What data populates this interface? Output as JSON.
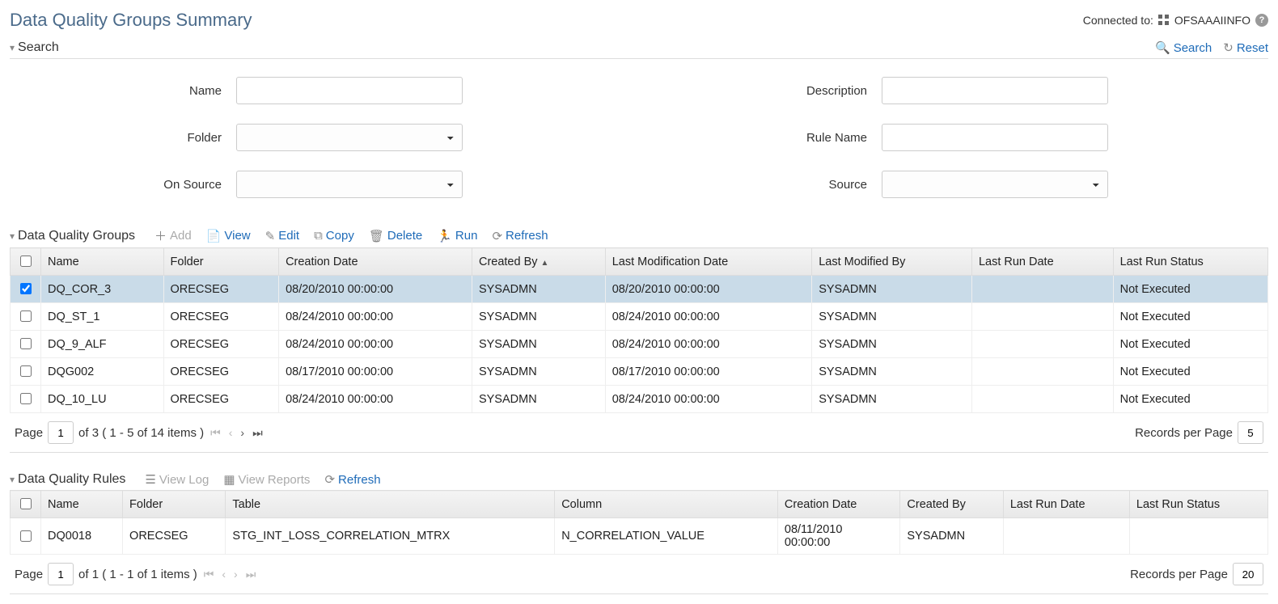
{
  "header": {
    "title": "Data Quality Groups Summary",
    "connected_label": "Connected to:",
    "connected_value": "OFSAAAIINFO"
  },
  "search_section": {
    "title": "Search",
    "search_btn": "Search",
    "reset_btn": "Reset",
    "labels": {
      "name": "Name",
      "description": "Description",
      "folder": "Folder",
      "rule_name": "Rule Name",
      "on_source": "On Source",
      "source": "Source"
    }
  },
  "groups_section": {
    "title": "Data Quality Groups",
    "toolbar": {
      "add": "Add",
      "view": "View",
      "edit": "Edit",
      "copy": "Copy",
      "delete": "Delete",
      "run": "Run",
      "refresh": "Refresh"
    },
    "columns": [
      "Name",
      "Folder",
      "Creation Date",
      "Created By",
      "Last Modification Date",
      "Last Modified By",
      "Last Run Date",
      "Last Run Status"
    ],
    "sort_col_index": 3,
    "rows": [
      {
        "checked": true,
        "cells": [
          "DQ_COR_3",
          "ORECSEG",
          "08/20/2010 00:00:00",
          "SYSADMN",
          "08/20/2010 00:00:00",
          "SYSADMN",
          "",
          "Not Executed"
        ]
      },
      {
        "checked": false,
        "cells": [
          "DQ_ST_1",
          "ORECSEG",
          "08/24/2010 00:00:00",
          "SYSADMN",
          "08/24/2010 00:00:00",
          "SYSADMN",
          "",
          "Not Executed"
        ]
      },
      {
        "checked": false,
        "cells": [
          "DQ_9_ALF",
          "ORECSEG",
          "08/24/2010 00:00:00",
          "SYSADMN",
          "08/24/2010 00:00:00",
          "SYSADMN",
          "",
          "Not Executed"
        ]
      },
      {
        "checked": false,
        "cells": [
          "DQG002",
          "ORECSEG",
          "08/17/2010 00:00:00",
          "SYSADMN",
          "08/17/2010 00:00:00",
          "SYSADMN",
          "",
          "Not Executed"
        ]
      },
      {
        "checked": false,
        "cells": [
          "DQ_10_LU",
          "ORECSEG",
          "08/24/2010 00:00:00",
          "SYSADMN",
          "08/24/2010 00:00:00",
          "SYSADMN",
          "",
          "Not Executed"
        ]
      }
    ],
    "pager": {
      "page_label": "Page",
      "page": "1",
      "of_text": "of 3 ( 1 - 5 of 14 items )",
      "rpp_label": "Records per Page",
      "rpp": "5"
    }
  },
  "rules_section": {
    "title": "Data Quality Rules",
    "toolbar": {
      "view_log": "View Log",
      "view_reports": "View Reports",
      "refresh": "Refresh"
    },
    "columns": [
      "Name",
      "Folder",
      "Table",
      "Column",
      "Creation Date",
      "Created By",
      "Last Run Date",
      "Last Run Status"
    ],
    "rows": [
      {
        "checked": false,
        "cells": [
          "DQ0018",
          "ORECSEG",
          "STG_INT_LOSS_CORRELATION_MTRX",
          "N_CORRELATION_VALUE",
          "08/11/2010 00:00:00",
          "SYSADMN",
          "",
          ""
        ]
      }
    ],
    "pager": {
      "page_label": "Page",
      "page": "1",
      "of_text": "of 1 ( 1 - 1 of 1 items )",
      "rpp_label": "Records per Page",
      "rpp": "20"
    }
  }
}
